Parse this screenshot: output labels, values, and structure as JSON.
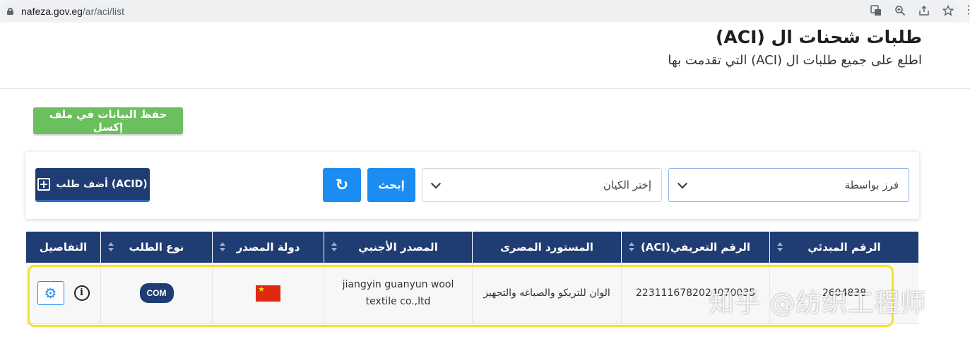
{
  "browser": {
    "domain": "nafeza.gov.eg",
    "path": "/ar/aci/list",
    "icons": [
      "translate-icon",
      "zoom-icon",
      "share-icon",
      "bookmark-star-icon",
      "menu-dots-icon"
    ]
  },
  "header": {
    "title": "طلبات شحنات ال (ACI)",
    "subtitle": "اطلع على جميع طلبات ال (ACI) التي تقدمت بها"
  },
  "actions": {
    "export_excel_label": "حفظ البيانات في ملف إكسل"
  },
  "filters": {
    "sort_placeholder": "فرز بواسطة",
    "entity_placeholder": "إختر الكيان",
    "search_label": "إبحث",
    "refresh_icon": "refresh-icon",
    "add_request_label": "أضف طلب (ACID)"
  },
  "table": {
    "columns": [
      {
        "label": "الرقم المبدئي",
        "sortable": true
      },
      {
        "label": "الرقم التعريفي(ACI)",
        "sortable": true
      },
      {
        "label": "المستورد المصرى",
        "sortable": false
      },
      {
        "label": "المصدر الأجنبي",
        "sortable": true
      },
      {
        "label": "دولة المصدر",
        "sortable": true
      },
      {
        "label": "نوع الطلب",
        "sortable": true
      },
      {
        "label": "التفاصيل",
        "sortable": false
      }
    ],
    "rows": [
      {
        "initial_number": "2604838",
        "aci_number": "2231116782024070035",
        "egyptian_importer": "الوان للتريكو والصباغه والتجهيز",
        "foreign_exporter": "jiangyin guanyun wool textile co.,ltd",
        "exporter_country": "China",
        "country_flag": "china-flag",
        "request_type": "COM"
      }
    ]
  },
  "watermark": {
    "text": "知乎 @纺织工程师"
  },
  "colors": {
    "navy": "#1f3c73",
    "blue": "#1b8cf2",
    "green": "#6cbf5e",
    "highlight": "#f5e22c"
  }
}
